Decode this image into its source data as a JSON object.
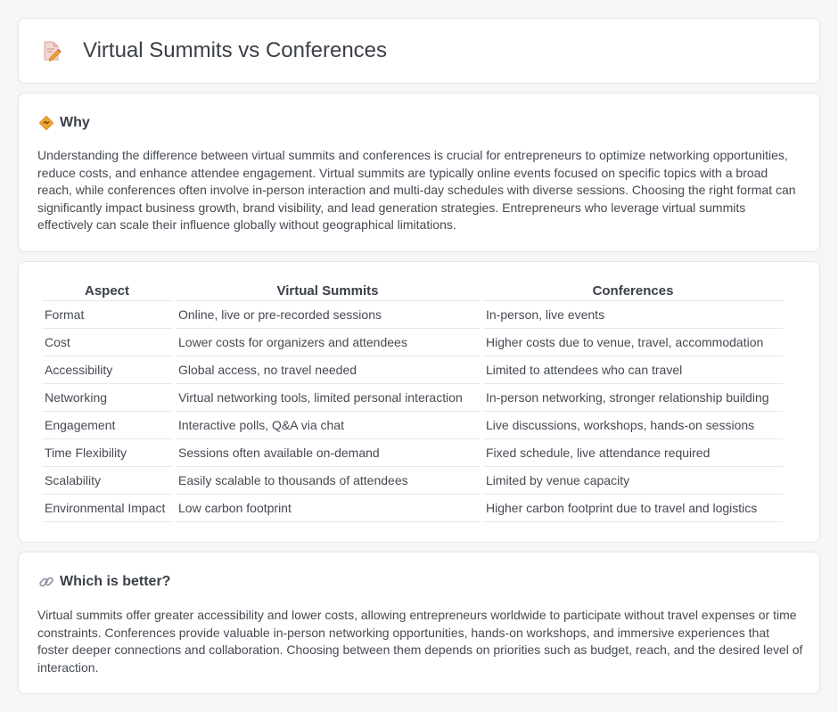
{
  "header": {
    "title": "Virtual Summits vs Conferences",
    "icon": "document-edit-icon"
  },
  "why": {
    "title": "Why",
    "icon": "diamond-warning-icon",
    "body": "Understanding the difference between virtual summits and conferences is crucial for entrepreneurs to optimize networking opportunities, reduce costs, and enhance attendee engagement. Virtual summits are typically online events focused on specific topics with a broad reach, while conferences often involve in-person interaction and multi-day schedules with diverse sessions. Choosing the right format can significantly impact business growth, brand visibility, and lead generation strategies. Entrepreneurs who leverage virtual summits effectively can scale their influence globally without geographical limitations."
  },
  "table": {
    "headers": [
      "Aspect",
      "Virtual Summits",
      "Conferences"
    ],
    "rows": [
      [
        "Format",
        "Online, live or pre-recorded sessions",
        "In-person, live events"
      ],
      [
        "Cost",
        "Lower costs for organizers and attendees",
        "Higher costs due to venue, travel, accommodation"
      ],
      [
        "Accessibility",
        "Global access, no travel needed",
        "Limited to attendees who can travel"
      ],
      [
        "Networking",
        "Virtual networking tools, limited personal interaction",
        "In-person networking, stronger relationship building"
      ],
      [
        "Engagement",
        "Interactive polls, Q&A via chat",
        "Live discussions, workshops, hands-on sessions"
      ],
      [
        "Time Flexibility",
        "Sessions often available on-demand",
        "Fixed schedule, live attendance required"
      ],
      [
        "Scalability",
        "Easily scalable to thousands of attendees",
        "Limited by venue capacity"
      ],
      [
        "Environmental Impact",
        "Low carbon footprint",
        "Higher carbon footprint due to travel and logistics"
      ]
    ]
  },
  "better": {
    "title": "Which is better?",
    "icon": "link-icon",
    "body": "Virtual summits offer greater accessibility and lower costs, allowing entrepreneurs worldwide to participate without travel expenses or time constraints. Conferences provide valuable in-person networking opportunities, hands-on workshops, and immersive experiences that foster deeper connections and collaboration. Choosing between them depends on priorities such as budget, reach, and the desired level of interaction."
  },
  "colors": {
    "background": "#f5f6f8",
    "card": "#ffffff",
    "border": "#e3e6ea",
    "text": "#454a52",
    "accent": "#f0a030"
  }
}
